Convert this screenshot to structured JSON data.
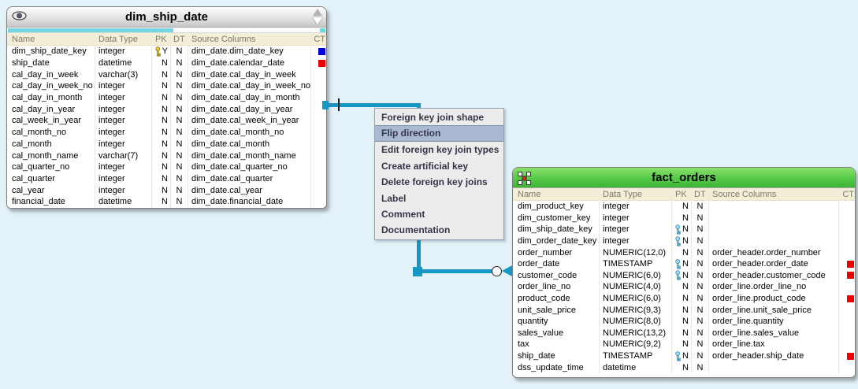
{
  "connector": {
    "color": "#1797c3"
  },
  "dim_table": {
    "title": "dim_ship_date",
    "headers": {
      "name": "Name",
      "type": "Data Type",
      "pk": "PK",
      "dt": "DT",
      "source": "Source Columns",
      "ct": "CT"
    },
    "rows": [
      {
        "name": "dim_ship_date_key",
        "type": "integer",
        "key": "gold",
        "pk": "Y",
        "dt": "N",
        "source": "dim_date.dim_date_key",
        "ct": "#0000e0"
      },
      {
        "name": "ship_date",
        "type": "datetime",
        "key": "",
        "pk": "N",
        "dt": "N",
        "source": "dim_date.calendar_date",
        "ct": "#ee0000"
      },
      {
        "name": "cal_day_in_week",
        "type": "varchar(3)",
        "key": "",
        "pk": "N",
        "dt": "N",
        "source": "dim_date.cal_day_in_week",
        "ct": ""
      },
      {
        "name": "cal_day_in_week_no",
        "type": "integer",
        "key": "",
        "pk": "N",
        "dt": "N",
        "source": "dim_date.cal_day_in_week_no",
        "ct": ""
      },
      {
        "name": "cal_day_in_month",
        "type": "integer",
        "key": "",
        "pk": "N",
        "dt": "N",
        "source": "dim_date.cal_day_in_month",
        "ct": ""
      },
      {
        "name": "cal_day_in_year",
        "type": "integer",
        "key": "",
        "pk": "N",
        "dt": "N",
        "source": "dim_date.cal_day_in_year",
        "ct": ""
      },
      {
        "name": "cal_week_in_year",
        "type": "integer",
        "key": "",
        "pk": "N",
        "dt": "N",
        "source": "dim_date.cal_week_in_year",
        "ct": ""
      },
      {
        "name": "cal_month_no",
        "type": "integer",
        "key": "",
        "pk": "N",
        "dt": "N",
        "source": "dim_date.cal_month_no",
        "ct": ""
      },
      {
        "name": "cal_month",
        "type": "integer",
        "key": "",
        "pk": "N",
        "dt": "N",
        "source": "dim_date.cal_month",
        "ct": ""
      },
      {
        "name": "cal_month_name",
        "type": "varchar(7)",
        "key": "",
        "pk": "N",
        "dt": "N",
        "source": "dim_date.cal_month_name",
        "ct": ""
      },
      {
        "name": "cal_quarter_no",
        "type": "integer",
        "key": "",
        "pk": "N",
        "dt": "N",
        "source": "dim_date.cal_quarter_no",
        "ct": ""
      },
      {
        "name": "cal_quarter",
        "type": "integer",
        "key": "",
        "pk": "N",
        "dt": "N",
        "source": "dim_date.cal_quarter",
        "ct": ""
      },
      {
        "name": "cal_year",
        "type": "integer",
        "key": "",
        "pk": "N",
        "dt": "N",
        "source": "dim_date.cal_year",
        "ct": ""
      },
      {
        "name": "financial_date",
        "type": "datetime",
        "key": "",
        "pk": "N",
        "dt": "N",
        "source": "dim_date.financial_date",
        "ct": ""
      }
    ]
  },
  "fact_table": {
    "title": "fact_orders",
    "headers": {
      "name": "Name",
      "type": "Data Type",
      "pk": "PK",
      "dt": "DT",
      "source": "Source Columns",
      "ct": "CT"
    },
    "rows": [
      {
        "name": "dim_product_key",
        "type": "integer",
        "key": "",
        "pk": "N",
        "dt": "N",
        "source": "",
        "ct": ""
      },
      {
        "name": "dim_customer_key",
        "type": "integer",
        "key": "",
        "pk": "N",
        "dt": "N",
        "source": "",
        "ct": ""
      },
      {
        "name": "dim_ship_date_key",
        "type": "integer",
        "key": "blue",
        "pk": "N",
        "dt": "N",
        "source": "",
        "ct": ""
      },
      {
        "name": "dim_order_date_key",
        "type": "integer",
        "key": "blue",
        "pk": "N",
        "dt": "N",
        "source": "",
        "ct": ""
      },
      {
        "name": "order_number",
        "type": "NUMERIC(12,0)",
        "key": "",
        "pk": "N",
        "dt": "N",
        "source": "order_header.order_number",
        "ct": ""
      },
      {
        "name": "order_date",
        "type": "TIMESTAMP",
        "key": "blue",
        "pk": "N",
        "dt": "N",
        "source": "order_header.order_date",
        "ct": "#ee0000"
      },
      {
        "name": "customer_code",
        "type": "NUMERIC(6,0)",
        "key": "blue",
        "pk": "N",
        "dt": "N",
        "source": "order_header.customer_code",
        "ct": "#ee0000"
      },
      {
        "name": "order_line_no",
        "type": "NUMERIC(4,0)",
        "key": "",
        "pk": "N",
        "dt": "N",
        "source": "order_line.order_line_no",
        "ct": ""
      },
      {
        "name": "product_code",
        "type": "NUMERIC(6,0)",
        "key": "",
        "pk": "N",
        "dt": "N",
        "source": "order_line.product_code",
        "ct": "#ee0000"
      },
      {
        "name": "unit_sale_price",
        "type": "NUMERIC(9,3)",
        "key": "",
        "pk": "N",
        "dt": "N",
        "source": "order_line.unit_sale_price",
        "ct": ""
      },
      {
        "name": "quantity",
        "type": "NUMERIC(8,0)",
        "key": "",
        "pk": "N",
        "dt": "N",
        "source": "order_line.quantity",
        "ct": ""
      },
      {
        "name": "sales_value",
        "type": "NUMERIC(13,2)",
        "key": "",
        "pk": "N",
        "dt": "N",
        "source": "order_line.sales_value",
        "ct": ""
      },
      {
        "name": "tax",
        "type": "NUMERIC(9,2)",
        "key": "",
        "pk": "N",
        "dt": "N",
        "source": "order_line.tax",
        "ct": ""
      },
      {
        "name": "ship_date",
        "type": "TIMESTAMP",
        "key": "blue",
        "pk": "N",
        "dt": "N",
        "source": "order_header.ship_date",
        "ct": "#ee0000"
      },
      {
        "name": "dss_update_time",
        "type": "datetime",
        "key": "",
        "pk": "N",
        "dt": "N",
        "source": "",
        "ct": ""
      }
    ]
  },
  "context_menu": {
    "items": [
      {
        "label": "Foreign key join shape",
        "state": ""
      },
      {
        "label": "Flip direction",
        "state": "selected"
      },
      {
        "label": "Edit foreign key join types",
        "state": ""
      },
      {
        "label": "Create artificial key",
        "state": ""
      },
      {
        "label": "Delete foreign key joins",
        "state": ""
      },
      {
        "label": "Label",
        "state": ""
      },
      {
        "label": "Comment",
        "state": ""
      },
      {
        "label": "Documentation",
        "state": ""
      }
    ]
  }
}
